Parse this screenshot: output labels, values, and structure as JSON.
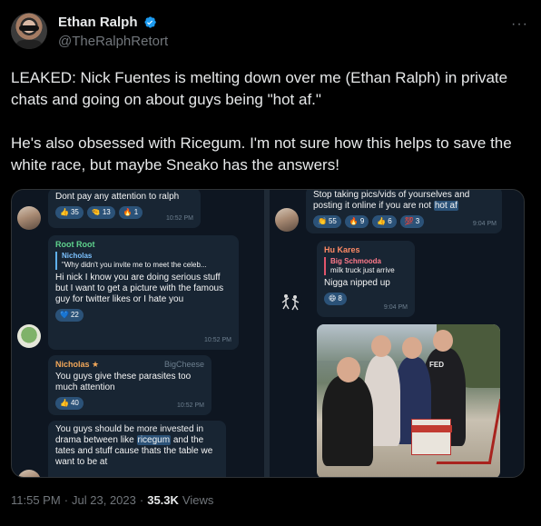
{
  "author": {
    "name": "Ethan Ralph",
    "handle": "@TheRalphRetort",
    "verified": true,
    "verified_color": "#1d9bf0"
  },
  "more_icon": "more-dots-icon",
  "tweet": {
    "text_p1": "LEAKED: Nick Fuentes is melting down over me (Ethan Ralph) in private chats and going on about guys being \"hot af.\"",
    "text_p2": "He's also obsessed with Ricegum. I'm not sure how this helps to save the white race, but maybe Sneako has the answers!"
  },
  "left_chat": {
    "msg1": {
      "text": "Dont pay any attention to ralph",
      "time": "10:52 PM",
      "reactions": [
        {
          "emoji": "👍",
          "count": "35"
        },
        {
          "emoji": "🤏",
          "count": "13"
        },
        {
          "emoji": "🔥",
          "count": "1"
        }
      ]
    },
    "msg2": {
      "sender": "Root Root",
      "sender_color": "#5fd38d",
      "reply_name": "Nicholas",
      "reply_text": "\"Why didn't you invite me to meet the celeb...",
      "text": "Hi nick I know you are doing serious stuff but I want to get a picture with the famous guy for twitter likes or I hate you",
      "time": "10:52 PM",
      "reactions": [
        {
          "emoji": "💙",
          "count": "22"
        }
      ]
    },
    "msg3": {
      "sender": "Nicholas ★",
      "sender_color": "#f3a85a",
      "tag": "BigCheese",
      "text": "You guys give these parasites too much attention",
      "time": "10:52 PM",
      "reactions": [
        {
          "emoji": "👍",
          "count": "40"
        }
      ]
    },
    "msg4": {
      "text_a": "You guys should be more invested in drama between like ",
      "highlight": "ricegum",
      "text_b": " and the tates and stuff cause thats the table we want to be at"
    }
  },
  "right_chat": {
    "msg1": {
      "text_a": "Stop taking pics/vids of yourselves and posting it online if you are not ",
      "highlight": "hot af",
      "time": "9:04 PM",
      "reactions": [
        {
          "emoji": "👏",
          "count": "55"
        },
        {
          "emoji": "🔥",
          "count": "9"
        },
        {
          "emoji": "👍",
          "count": "6"
        },
        {
          "emoji": "💯",
          "count": "3"
        }
      ]
    },
    "msg2": {
      "sender": "Hu Kares",
      "sender_color": "#ff8a65",
      "reply_name": "Big Schmooda",
      "reply_text": "milk truck just arrive",
      "text": "Nigga nipped up",
      "time": "9:04 PM",
      "reactions": [
        {
          "emoji": "😄",
          "count": "8"
        }
      ]
    },
    "photo_label": "FED"
  },
  "footer": {
    "time": "11:55 PM",
    "sep": "·",
    "date": "Jul 23, 2023",
    "views_count": "35.3K",
    "views_label": "Views"
  }
}
